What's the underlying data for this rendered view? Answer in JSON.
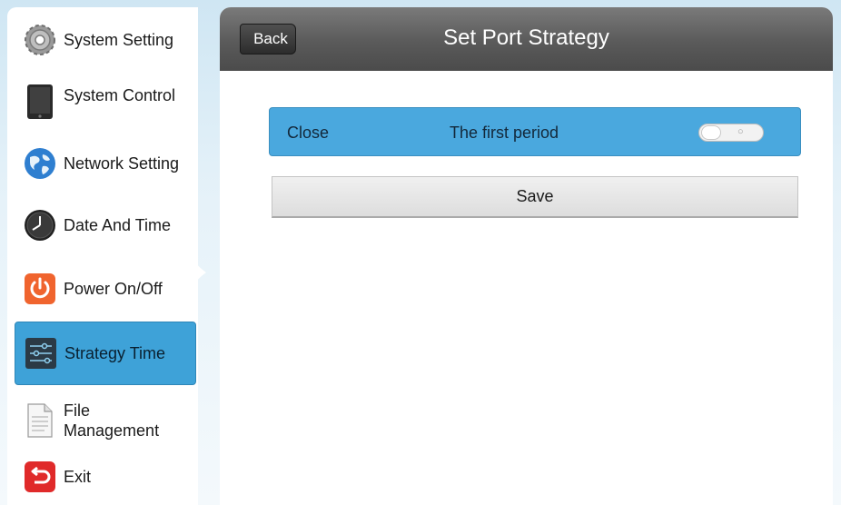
{
  "sidebar": {
    "items": [
      {
        "label": "System Setting",
        "icon": "gear-icon"
      },
      {
        "label": "System Control",
        "icon": "tablet-icon"
      },
      {
        "label": "Network Setting",
        "icon": "globe-icon"
      },
      {
        "label": "Date And Time",
        "icon": "clock-icon"
      },
      {
        "label": "Power On/Off",
        "icon": "power-icon"
      },
      {
        "label": "Strategy Time",
        "icon": "sliders-icon",
        "active": true
      },
      {
        "label": "File Management",
        "icon": "document-icon"
      },
      {
        "label": "Exit",
        "icon": "exit-icon"
      }
    ]
  },
  "header": {
    "back_label": "Back",
    "title": "Set Port Strategy"
  },
  "strategy": {
    "status": "Close",
    "period": "The first period",
    "toggle_off_symbol": "○"
  },
  "actions": {
    "save_label": "Save"
  },
  "colors": {
    "accent": "#4aa8de",
    "titlebar": "#5a5a5a"
  }
}
